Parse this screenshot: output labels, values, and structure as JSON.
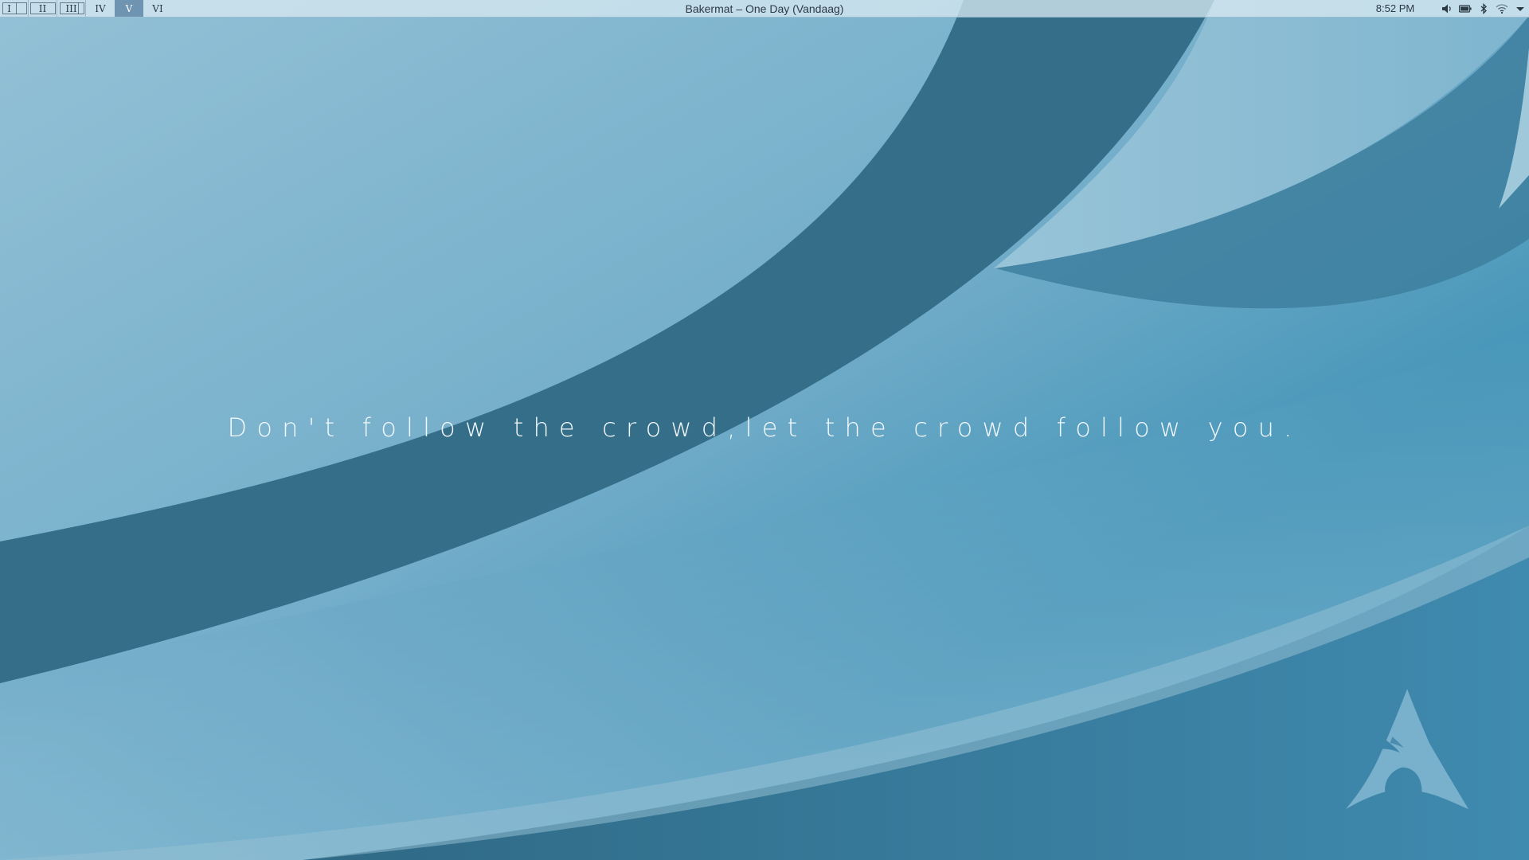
{
  "topbar": {
    "workspaces": [
      {
        "label": "I",
        "active": false
      },
      {
        "label": "II",
        "active": false
      },
      {
        "label": "III",
        "active": false
      },
      {
        "label": "IV",
        "active": false
      },
      {
        "label": "V",
        "active": true
      },
      {
        "label": "VI",
        "active": false
      }
    ],
    "window_title": "Bakermat – One Day (Vandaag)",
    "clock": "8:52 PM",
    "tray_icons": [
      "volume-icon",
      "battery-icon",
      "bluetooth-icon",
      "wifi-icon",
      "chevron-down-icon"
    ]
  },
  "desktop": {
    "quote": "Don't follow the crowd,let the crowd follow you.",
    "logo": "arch-linux-logo"
  },
  "colors": {
    "wallpaper_light": "#8dbcd2",
    "wallpaper_mid": "#4596b8",
    "wallpaper_dark": "#356d87",
    "active_workspace": "#6f94b2",
    "topbar_text": "#2c3a44"
  }
}
